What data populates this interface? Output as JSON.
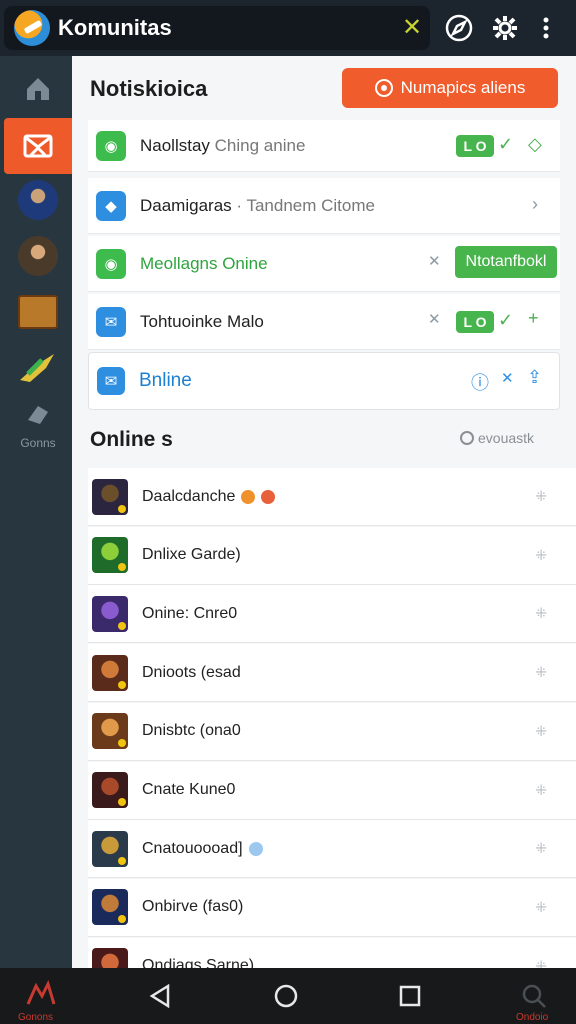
{
  "app": {
    "title": "Komunitas"
  },
  "header": {
    "title": "Notiskioica",
    "action_label": "Numapics aliens"
  },
  "cards": [
    {
      "label": "Naollstay",
      "sub": "Ching anine",
      "pill": "L O"
    },
    {
      "label": "Daamigaras",
      "sub": "· Tandnem Citome"
    },
    {
      "label": "Meollagns Onine",
      "button": "Ntotanfbokl"
    },
    {
      "label": "Tohtuoinke Malo",
      "pill": "L O"
    },
    {
      "label": "Bnline"
    }
  ],
  "sidebar": {
    "label": "Gonns"
  },
  "section": {
    "title": "Online s",
    "meta": "evouastk"
  },
  "list": [
    {
      "name": "Daalcdanche",
      "colors": [
        "#2b2540",
        "#6b4f2a"
      ]
    },
    {
      "name": "Dnlixe Garde)",
      "colors": [
        "#1f6b2a",
        "#8ccf3a"
      ]
    },
    {
      "name": "Onine: Cnre0",
      "colors": [
        "#3a2a6b",
        "#8a5acf"
      ]
    },
    {
      "name": "Dnioots (esad",
      "colors": [
        "#5a2a1a",
        "#d07a3a"
      ]
    },
    {
      "name": "Dnisbtc (ona0",
      "colors": [
        "#6b3a1a",
        "#e09a4a"
      ]
    },
    {
      "name": "Cnate Kune0",
      "colors": [
        "#3a1a1a",
        "#a84a2a"
      ]
    },
    {
      "name": "Cnatouoooad]",
      "colors": [
        "#2a3a4a",
        "#c89a3a"
      ]
    },
    {
      "name": "Onbirve (fas0)",
      "colors": [
        "#1a2a5a",
        "#c07a3a"
      ]
    },
    {
      "name": "Ondiags Sarne)",
      "colors": [
        "#4a1a1a",
        "#d06a3a"
      ]
    }
  ],
  "bottom": {
    "left_label": "Gonons",
    "right_label": "Ondoio"
  }
}
